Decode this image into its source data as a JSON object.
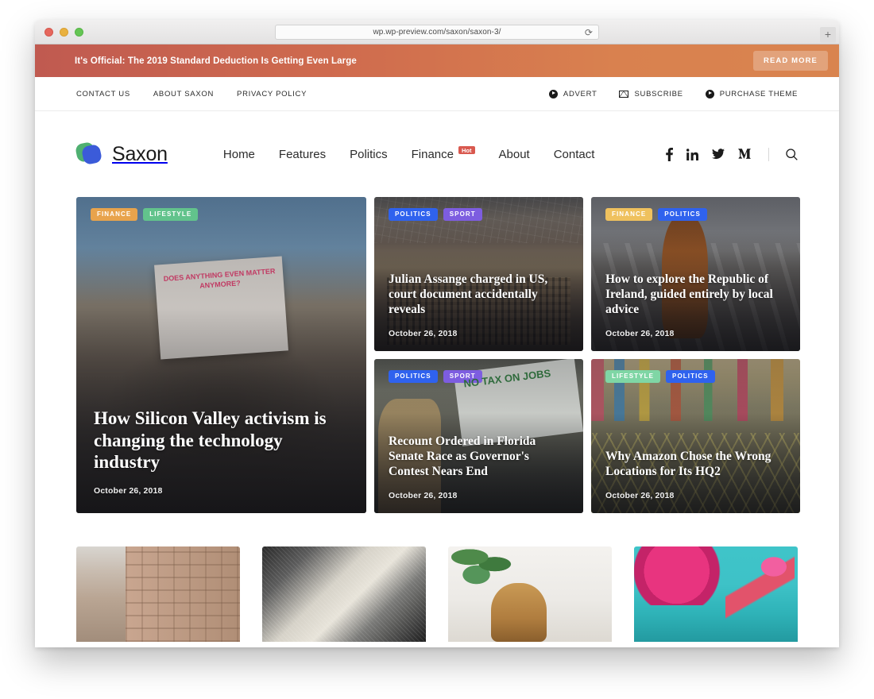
{
  "browser": {
    "url": "wp.wp-preview.com/saxon/saxon-3/",
    "reload_icon": "reload-icon",
    "new_tab_icon": "plus-icon",
    "traffic_lights": [
      "close",
      "minimize",
      "maximize"
    ]
  },
  "promo": {
    "message": "It's Official: The 2019 Standard Deduction Is Getting Even Large",
    "button_label": "READ MORE",
    "gradient_from": "#c05a50",
    "gradient_to": "#d9844f"
  },
  "top_nav": {
    "left": [
      {
        "label": "CONTACT US"
      },
      {
        "label": "ABOUT SAXON"
      },
      {
        "label": "PRIVACY POLICY"
      }
    ],
    "right": [
      {
        "label": "ADVERT",
        "icon": "play-circle-icon"
      },
      {
        "label": "SUBSCRIBE",
        "icon": "envelope-icon"
      },
      {
        "label": "PURCHASE THEME",
        "icon": "play-circle-icon"
      }
    ]
  },
  "header": {
    "brand": "Saxon",
    "logo_colors": {
      "green": "#4fb071",
      "blue": "#3b5bd9"
    },
    "nav": [
      {
        "label": "Home",
        "badge": null
      },
      {
        "label": "Features",
        "badge": null
      },
      {
        "label": "Politics",
        "badge": null
      },
      {
        "label": "Finance",
        "badge": "Hot"
      },
      {
        "label": "About",
        "badge": null
      },
      {
        "label": "Contact",
        "badge": null
      }
    ],
    "social": [
      {
        "name": "facebook-icon"
      },
      {
        "name": "linkedin-icon"
      },
      {
        "name": "twitter-icon"
      },
      {
        "name": "medium-icon"
      }
    ],
    "search_icon": "search-icon"
  },
  "hero": {
    "cards": [
      {
        "id": "silicon-valley",
        "tags": [
          {
            "label": "FINANCE",
            "color": "#e8a34c"
          },
          {
            "label": "LIFESTYLE",
            "color": "#62c38c"
          }
        ],
        "title": "How Silicon Valley activism is changing the technology industry",
        "date": "October 26, 2018",
        "image_alt": "protest-crowd-with-sign"
      },
      {
        "id": "julian-assange",
        "tags": [
          {
            "label": "POLITICS",
            "color": "#2f62ee"
          },
          {
            "label": "SPORT",
            "color": "#7d5de0"
          }
        ],
        "title": "Julian Assange charged in US, court document accidentally reveals",
        "date": "October 26, 2018",
        "image_alt": "parliament-chamber-interior"
      },
      {
        "id": "republic-of-ireland",
        "tags": [
          {
            "label": "FINANCE",
            "color": "#efc15e"
          },
          {
            "label": "POLITICS",
            "color": "#2f62ee"
          }
        ],
        "title": "How to explore the Republic of Ireland, guided entirely by local advice",
        "date": "October 26, 2018",
        "image_alt": "woman-with-backpack-crossing-street"
      },
      {
        "id": "florida-recount",
        "tags": [
          {
            "label": "POLITICS",
            "color": "#2f62ee"
          },
          {
            "label": "SPORT",
            "color": "#7d5de0"
          }
        ],
        "title": "Recount Ordered in Florida Senate Race as Governor's Contest Nears End",
        "date": "October 26, 2018",
        "image_alt": "protester-holding-no-tax-on-jobs-sign"
      },
      {
        "id": "amazon-hq2",
        "tags": [
          {
            "label": "LIFESTYLE",
            "color": "#7fd6a5"
          },
          {
            "label": "POLITICS",
            "color": "#2f62ee"
          }
        ],
        "title": "Why Amazon Chose the Wrong Locations for Its HQ2",
        "date": "October 26, 2018",
        "image_alt": "hong-kong-street-aerial-view"
      }
    ]
  },
  "lower_strip": {
    "thumbs": [
      {
        "id": "thumb-city",
        "image_alt": "european-city-street-buildings"
      },
      {
        "id": "thumb-money",
        "image_alt": "close-up-of-banknote"
      },
      {
        "id": "thumb-office",
        "image_alt": "woman-at-desk-with-plants"
      },
      {
        "id": "thumb-flamingo",
        "image_alt": "pink-flamingo-mural-artwork"
      }
    ]
  },
  "signs": {
    "protest_sign": "DOES ANYTHING EVEN MATTER ANYMORE?",
    "rally_sign": "NO TAX ON JOBS"
  }
}
